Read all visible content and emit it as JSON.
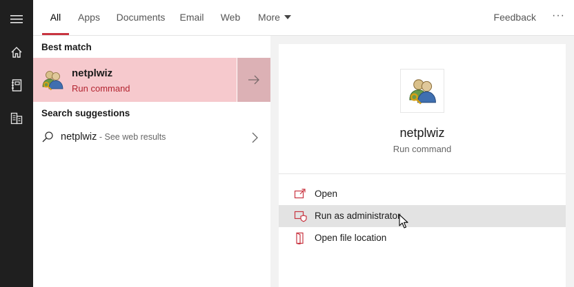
{
  "nav_rail": {
    "items": [
      {
        "icon": "hamburger-menu-icon"
      },
      {
        "icon": "home-icon"
      },
      {
        "icon": "notebook-icon"
      },
      {
        "icon": "building-documents-icon"
      }
    ]
  },
  "tabs": [
    {
      "label": "All",
      "active": true
    },
    {
      "label": "Apps"
    },
    {
      "label": "Documents"
    },
    {
      "label": "Email"
    },
    {
      "label": "Web"
    },
    {
      "label": "More"
    }
  ],
  "topbar": {
    "feedback_label": "Feedback",
    "ellipsis": "···"
  },
  "results": {
    "best_match_header": "Best match",
    "best_match": {
      "title": "netplwiz",
      "subtitle": "Run command",
      "icon": "users-key-icon"
    },
    "suggestions_header": "Search suggestions",
    "suggestion": {
      "query": "netplwiz",
      "separator": " - ",
      "web_text": "See web results"
    }
  },
  "preview": {
    "app_name": "netplwiz",
    "app_type": "Run command",
    "actions": [
      {
        "label": "Open",
        "icon": "open-icon"
      },
      {
        "label": "Run as administrator",
        "icon": "shield-admin-icon",
        "hover": true
      },
      {
        "label": "Open file location",
        "icon": "file-location-icon"
      }
    ]
  },
  "colors": {
    "accent": "#c8333f",
    "best_match_bg": "#f6c9cd",
    "rail_bg": "#1f1f1f"
  }
}
